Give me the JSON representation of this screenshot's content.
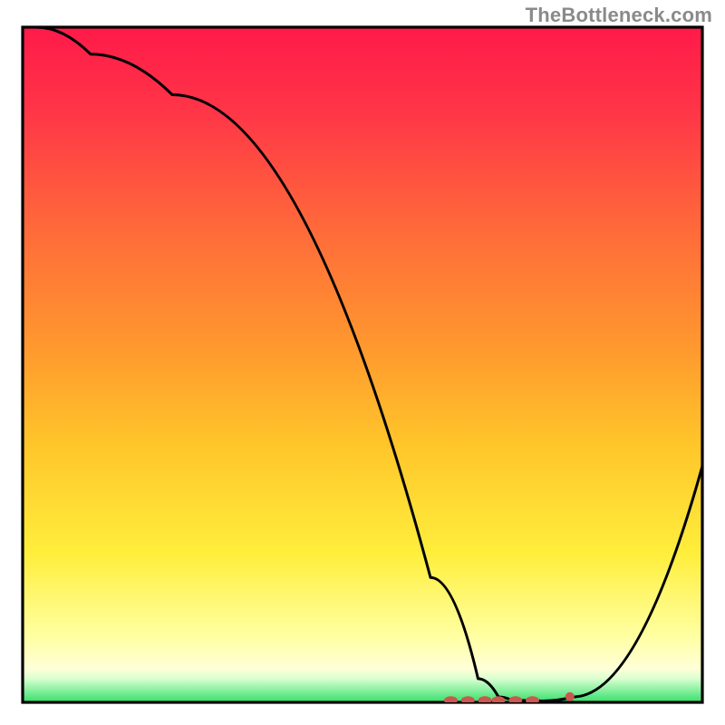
{
  "watermark": {
    "text": "TheBottleneck.com"
  },
  "chart_data": {
    "type": "line",
    "title": "",
    "xlabel": "",
    "ylabel": "",
    "x": [
      0,
      2,
      10,
      22,
      60,
      67,
      70,
      72,
      76.5,
      81,
      100
    ],
    "y": [
      101,
      100,
      96,
      90,
      18.5,
      3.5,
      0.8,
      0.3,
      0.2,
      0.8,
      35
    ],
    "xlim": [
      0,
      100
    ],
    "ylim": [
      0,
      100
    ],
    "series": [
      {
        "name": "curve",
        "description": "V-shaped black curve with minimum near x≈75"
      }
    ],
    "background": {
      "gradient_top": "#ff1a49",
      "gradient_mid": "#ffb300",
      "gradient_low": "#ffff66",
      "gradient_green": "#33e06b"
    },
    "annotations": [
      {
        "name": "bottom-dot-cluster",
        "x_range": [
          63,
          81
        ],
        "y": 0.3,
        "color": "#cc5650"
      }
    ]
  },
  "colors": {
    "frame": "#000000",
    "curve": "#000000",
    "dots": "#cc5650",
    "watermark": "#8a8a8a"
  }
}
